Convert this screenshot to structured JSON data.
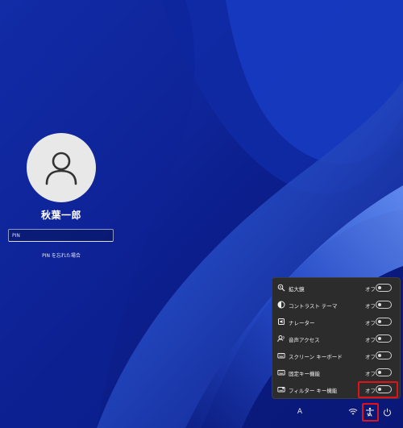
{
  "account": {
    "user_name": "秋葉一郎",
    "pin_placeholder": "PIN",
    "forgot_pin": "PIN を忘れた場合"
  },
  "accessibility_panel": {
    "items": [
      {
        "label": "拡大鏡",
        "state": "オフ",
        "enabled": false,
        "icon": "magnifier-icon"
      },
      {
        "label": "コントラスト テーマ",
        "state": "オフ",
        "enabled": false,
        "icon": "contrast-icon"
      },
      {
        "label": "ナレーター",
        "state": "オフ",
        "enabled": false,
        "icon": "narrator-icon"
      },
      {
        "label": "音声アクセス",
        "state": "オフ",
        "enabled": false,
        "icon": "voice-access-icon"
      },
      {
        "label": "スクリーン キーボード",
        "state": "オフ",
        "enabled": false,
        "icon": "keyboard-icon"
      },
      {
        "label": "固定キー機能",
        "state": "オフ",
        "enabled": false,
        "icon": "sticky-keys-icon"
      },
      {
        "label": "フィルター キー機能",
        "state": "オフ",
        "enabled": false,
        "icon": "filter-keys-icon"
      }
    ]
  },
  "tray": {
    "language": "A",
    "network_icon": "wifi-icon",
    "accessibility_icon": "accessibility-icon",
    "power_icon": "power-icon"
  },
  "colors": {
    "highlight": "#e0121a",
    "panel_bg": "#2c2c2c",
    "wallpaper_base": "#0f2596"
  }
}
